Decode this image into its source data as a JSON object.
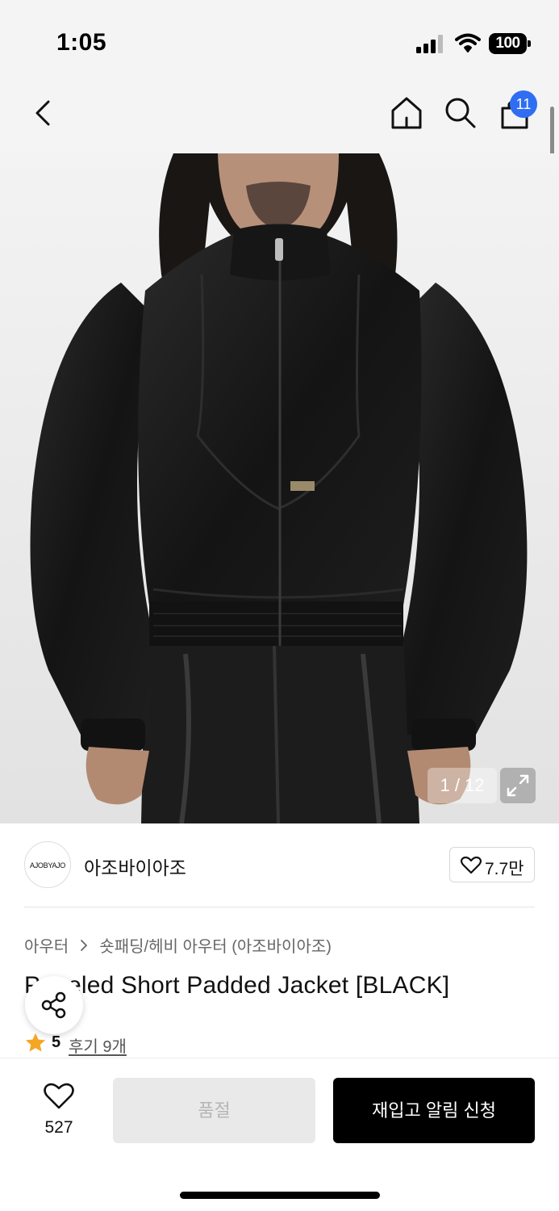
{
  "status_bar": {
    "time": "1:05",
    "battery": "100"
  },
  "nav": {
    "cart_count": "11"
  },
  "gallery": {
    "counter": "1 / 12"
  },
  "brand": {
    "logo_text": "AJOBYAJO",
    "name": "아조바이아조",
    "likes": "7.7만"
  },
  "breadcrumb": {
    "category": "아우터",
    "subcategory": "숏패딩/헤비 아우터 (아조바이아조)"
  },
  "product": {
    "title": "Paneled Short Padded Jacket [BLACK]",
    "rating": "5",
    "reviews": "후기 9개"
  },
  "bottom_bar": {
    "wish_count": "527",
    "soldout_label": "품절",
    "restock_label": "재입고 알림 신청"
  },
  "colors": {
    "badge": "#2f6ef2",
    "primary_button": "#000000",
    "disabled_button": "#e9e9e9",
    "star": "#f5a623"
  },
  "icons": [
    "back-chevron-icon",
    "home-icon",
    "search-icon",
    "shopping-bag-icon",
    "expand-icon",
    "heart-icon",
    "share-icon",
    "star-icon"
  ]
}
